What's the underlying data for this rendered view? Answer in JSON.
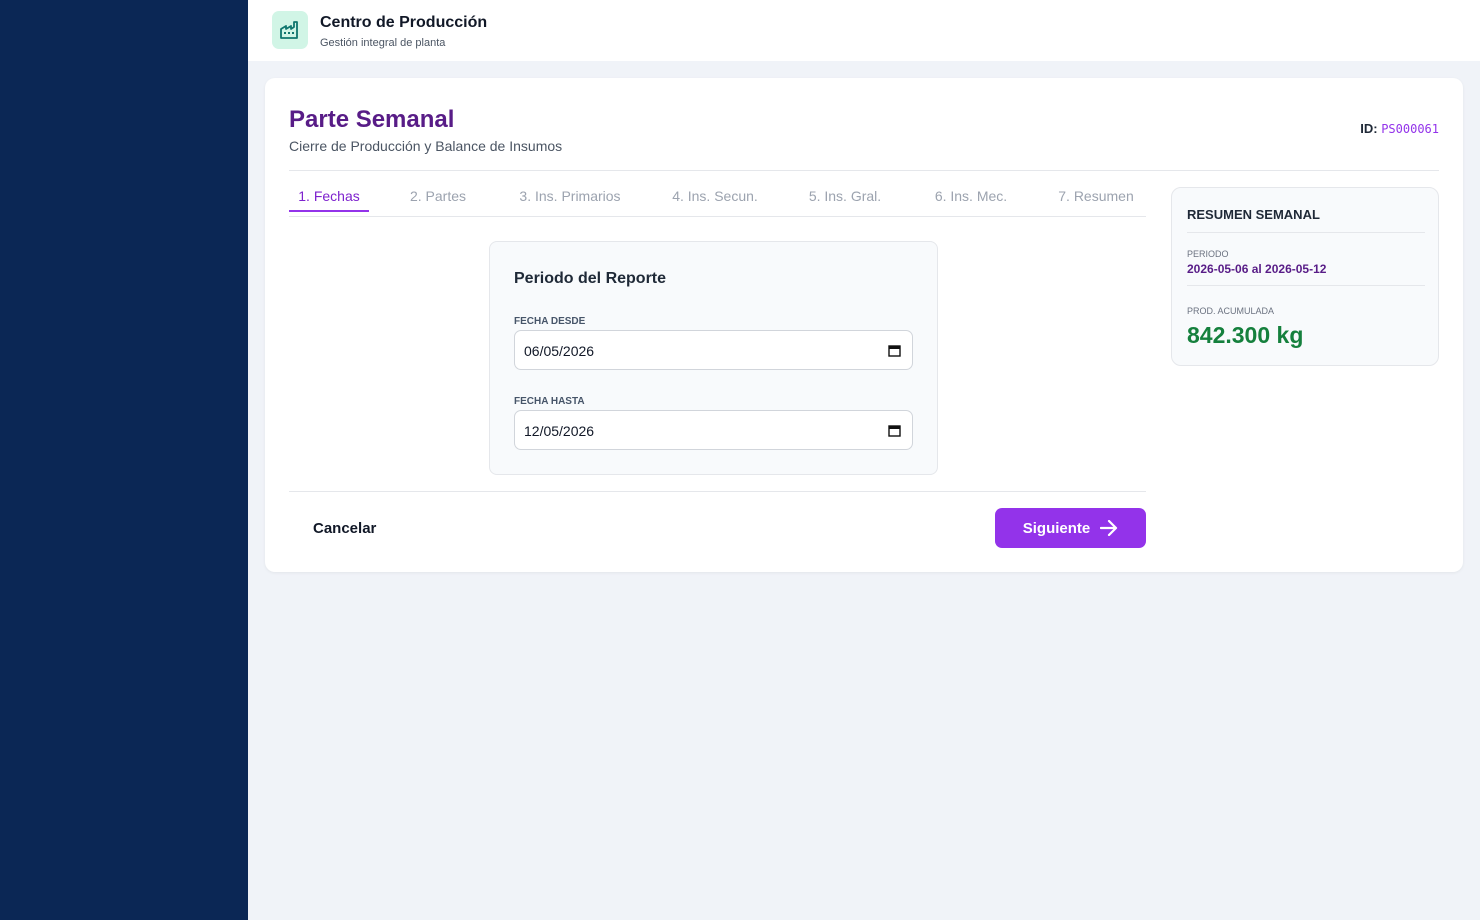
{
  "app": {
    "title": "Centro de Producción",
    "subtitle": "Gestión integral de planta",
    "logo_icon": "factory-icon"
  },
  "page": {
    "title": "Parte Semanal",
    "subtitle": "Cierre de Producción y Balance de Insumos",
    "id_label": "ID:",
    "id_value": "PS000061"
  },
  "tabs": [
    {
      "label": "1. Fechas",
      "active": true
    },
    {
      "label": "2. Partes",
      "active": false
    },
    {
      "label": "3. Ins. Primarios",
      "active": false
    },
    {
      "label": "4. Ins. Secun.",
      "active": false
    },
    {
      "label": "5. Ins. Gral.",
      "active": false
    },
    {
      "label": "6. Ins. Mec.",
      "active": false
    },
    {
      "label": "7. Resumen",
      "active": false
    }
  ],
  "form": {
    "title": "Periodo del Reporte",
    "fecha_desde_label": "FECHA DESDE",
    "fecha_desde_value": "06/05/2026",
    "fecha_hasta_label": "FECHA HASTA",
    "fecha_hasta_value": "12/05/2026",
    "calendar_icon": "calendar-icon"
  },
  "actions": {
    "cancel_label": "Cancelar",
    "next_label": "Siguiente",
    "next_icon": "arrow-right-icon"
  },
  "summary": {
    "title": "RESUMEN SEMANAL",
    "period_label": "PERIODO",
    "period_value": "2026-05-06 al 2026-05-12",
    "prod_label": "PROD. ACUMULADA",
    "prod_value": "842.300 kg"
  },
  "colors": {
    "sidebar": "#0b2755",
    "accent": "#9333ea",
    "title": "#581c87",
    "production": "#15803d",
    "logo_bg": "#d1f5e6"
  }
}
